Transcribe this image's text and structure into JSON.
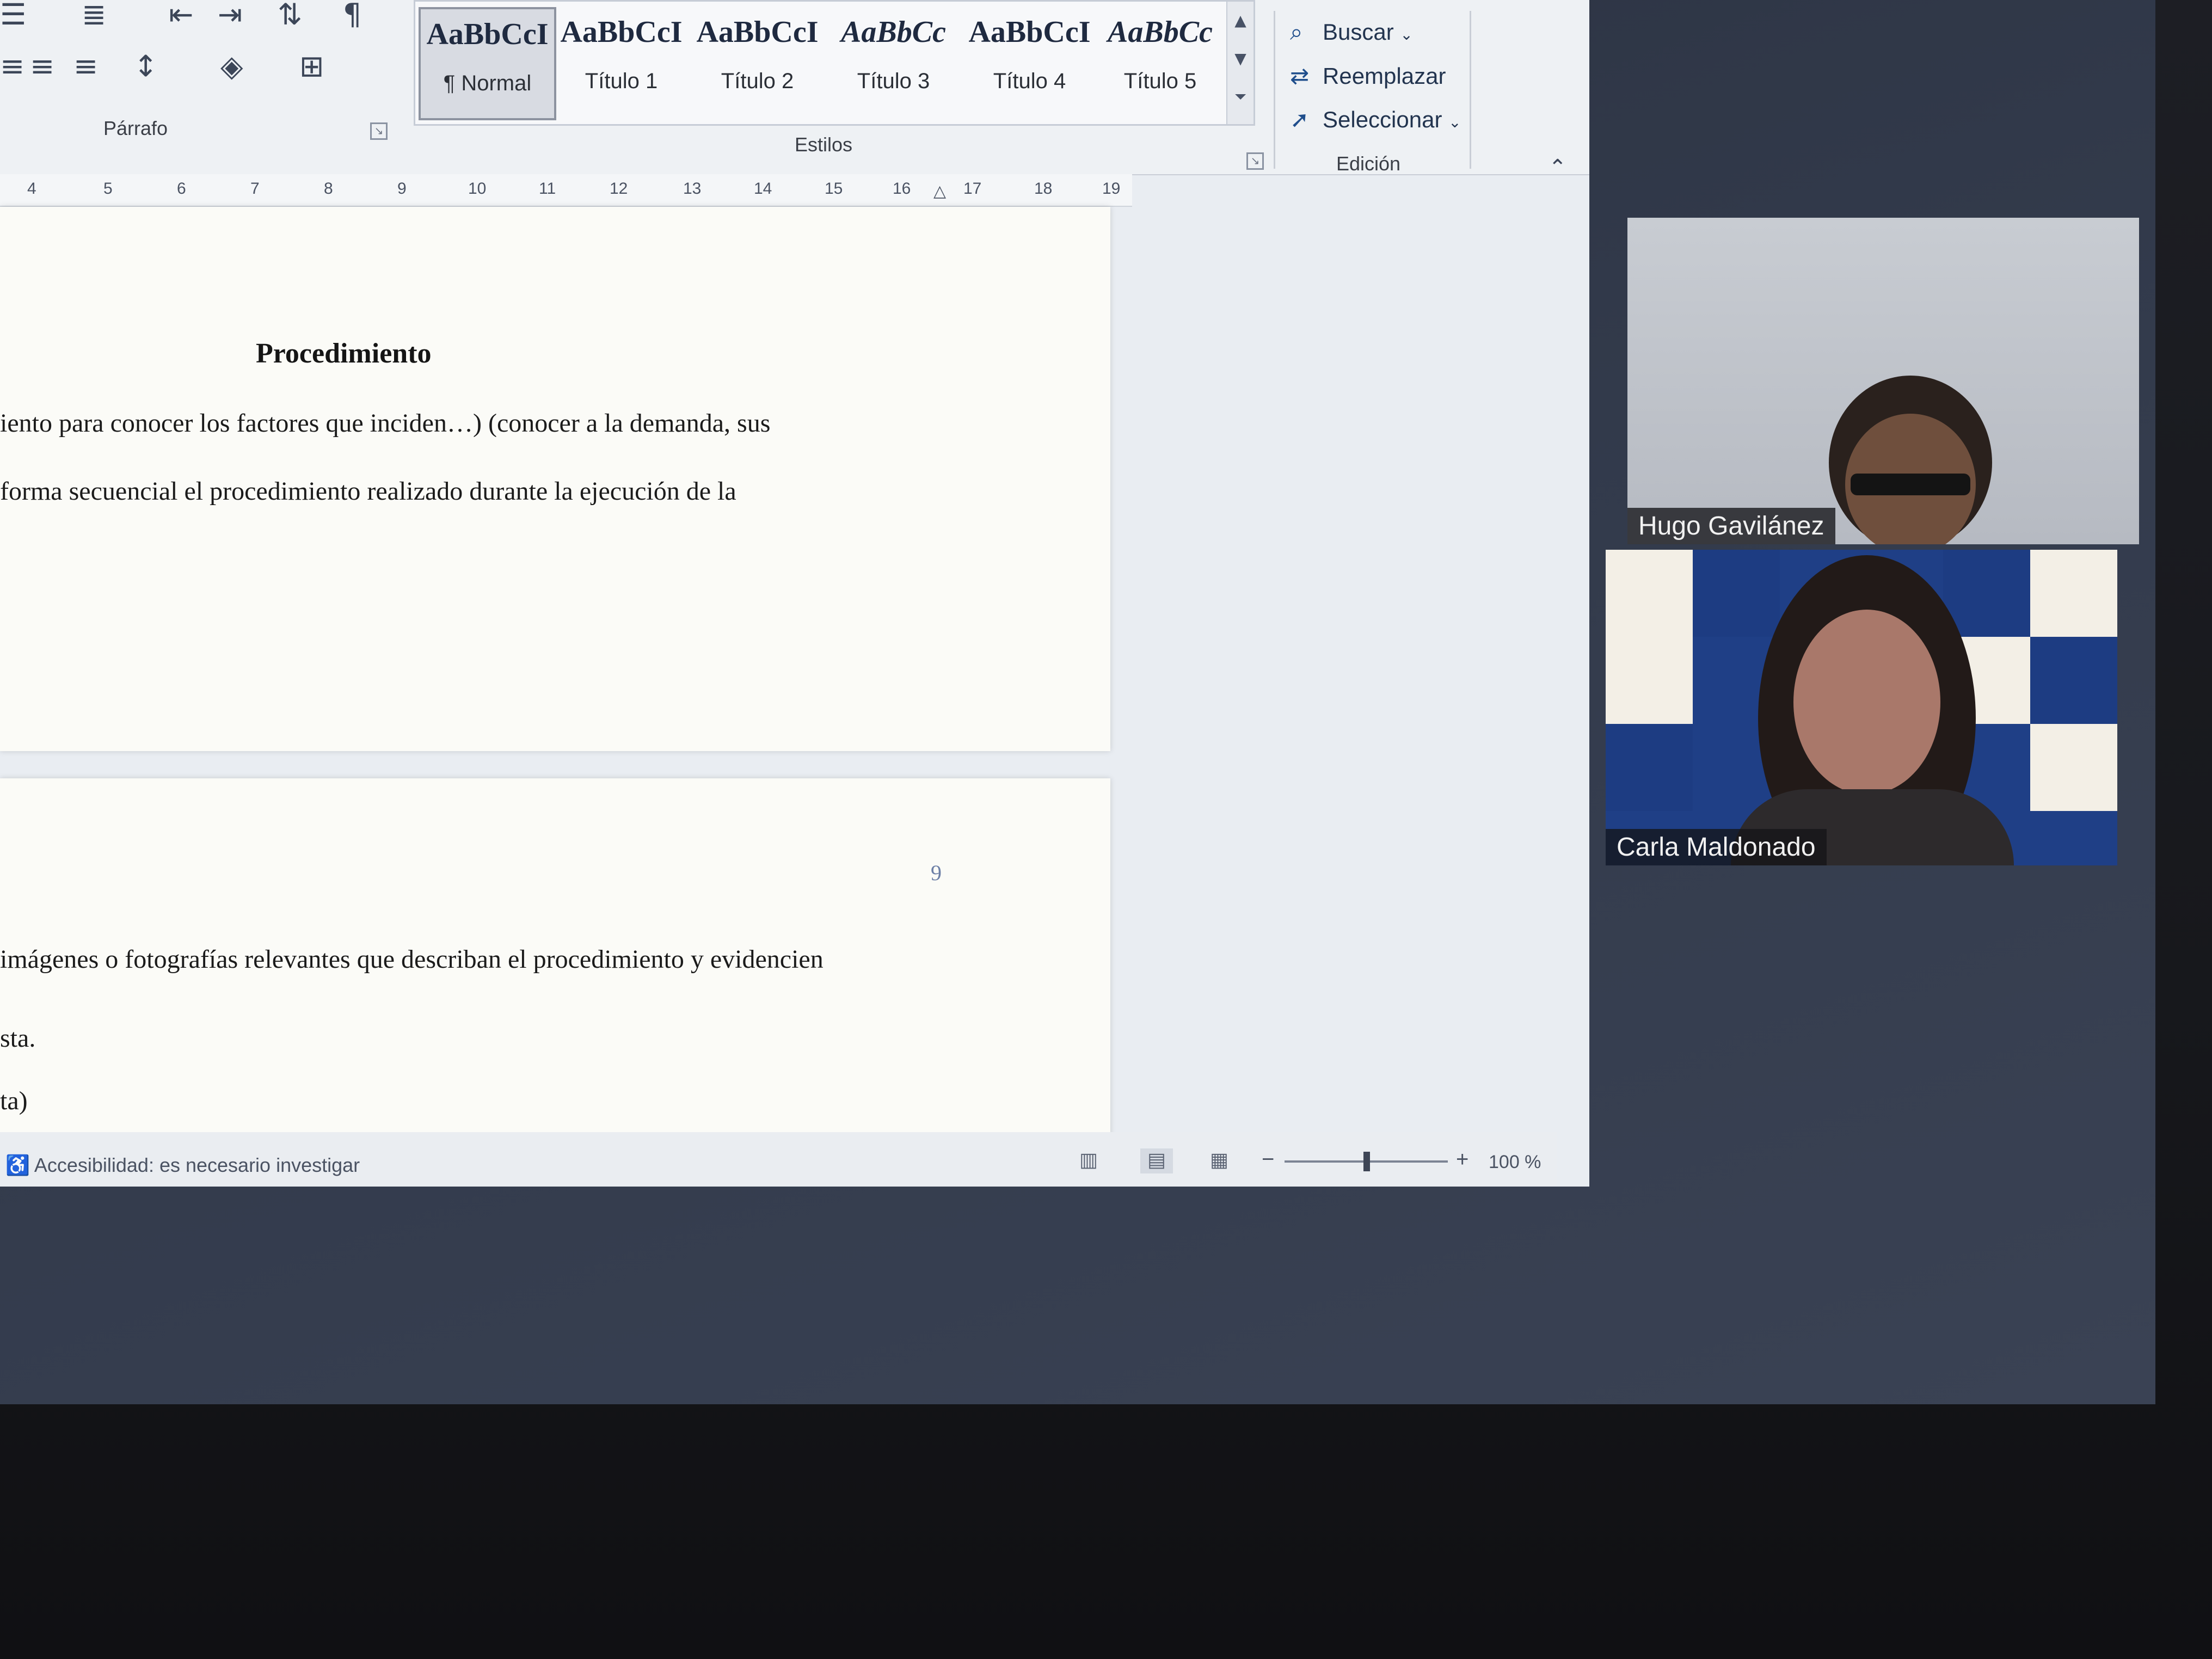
{
  "ribbon": {
    "paragraph_group_label": "Párrafo",
    "styles_group_label": "Estilos",
    "editing_group_label": "Edición",
    "styles": [
      {
        "sample": "AaBbCcI",
        "name": "¶ Normal"
      },
      {
        "sample": "AaBbCcI",
        "name": "Título 1"
      },
      {
        "sample": "AaBbCcI",
        "name": "Título 2"
      },
      {
        "sample": "AaBbCc",
        "name": "Título 3"
      },
      {
        "sample": "AaBbCcI",
        "name": "Título 4"
      },
      {
        "sample": "AaBbCc",
        "name": "Título 5"
      }
    ],
    "editing": {
      "find_label": "Buscar",
      "replace_label": "Reemplazar",
      "select_label": "Seleccionar"
    }
  },
  "ruler": {
    "marks": [
      "4",
      "5",
      "6",
      "7",
      "8",
      "9",
      "10",
      "11",
      "12",
      "13",
      "14",
      "15",
      "16",
      "17",
      "18",
      "19"
    ]
  },
  "document": {
    "page1": {
      "heading": "Procedimiento",
      "line1": "iento para conocer los factores que inciden…) (conocer a la demanda, sus",
      "line2": "forma secuencial el procedimiento realizado durante la ejecución de la"
    },
    "page2": {
      "page_number": "9",
      "line1": "imágenes o fotografías relevantes que describan el procedimiento y evidencien",
      "line2": "sta.",
      "line3": "ta)"
    }
  },
  "statusbar": {
    "accessibility": "Accesibilidad: es necesario investigar",
    "zoom_level": "100 %",
    "zoom_fraction": 0.5
  },
  "participants": [
    {
      "name": "Hugo Gavilánez"
    },
    {
      "name": "Carla Maldonado"
    }
  ],
  "colors": {
    "accent": "#1f4e8c",
    "tile_background": "#1f3f86"
  }
}
